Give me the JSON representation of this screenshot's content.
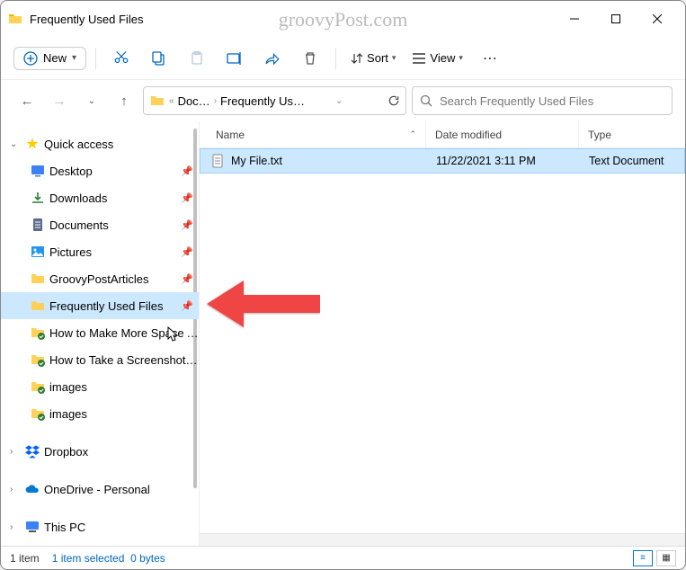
{
  "window": {
    "title": "Frequently Used Files"
  },
  "watermark": "groovyPost.com",
  "toolbar": {
    "new": "New",
    "sort": "Sort",
    "view": "View"
  },
  "breadcrumb": {
    "ellipsis": "«",
    "seg1": "Doc…",
    "seg2": "Frequently Us…"
  },
  "search": {
    "placeholder": "Search Frequently Used Files"
  },
  "columns": {
    "name": "Name",
    "date": "Date modified",
    "type": "Type"
  },
  "file": {
    "name": "My File.txt",
    "date": "11/22/2021 3:11 PM",
    "type": "Text Document"
  },
  "sidebar": {
    "quick": "Quick access",
    "desktop": "Desktop",
    "downloads": "Downloads",
    "documents": "Documents",
    "pictures": "Pictures",
    "groovy": "GroovyPostArticles",
    "freq": "Frequently Used Files",
    "space": "How to Make More Space Av",
    "screenshot": "How to Take a Screenshot on",
    "images1": "images",
    "images2": "images",
    "dropbox": "Dropbox",
    "onedrive": "OneDrive - Personal",
    "thispc": "This PC"
  },
  "status": {
    "count": "1 item",
    "selected": "1 item selected",
    "size": "0 bytes"
  }
}
